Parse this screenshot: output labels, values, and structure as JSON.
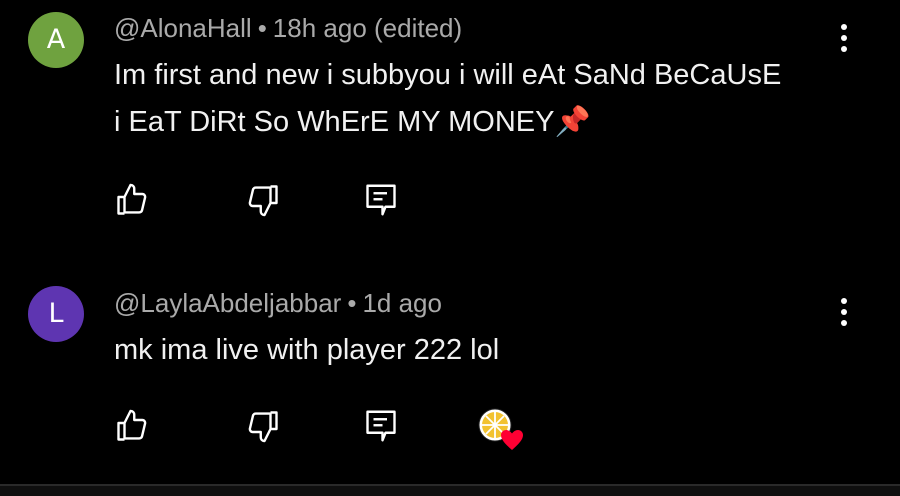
{
  "comments": [
    {
      "avatar_letter": "A",
      "avatar_color": "#6fa23f",
      "author": "@AlonaHall",
      "separator": "•",
      "time": "18h ago",
      "edited": "(edited)",
      "text": "Im first and new i subbyou i will eAt SaNd BeCaUsE i EaT DiRt So WhErE MY MONEY📌"
    },
    {
      "avatar_letter": "L",
      "avatar_color": "#5e35b1",
      "author": "@LaylaAbdeljabbar",
      "separator": "•",
      "time": "1d ago",
      "text": "mk ima live with player 222 lol"
    }
  ],
  "icons": {
    "like": "thumb-up-icon",
    "dislike": "thumb-down-icon",
    "reply": "reply-icon",
    "more": "more-vert-icon",
    "creator_heart": "creator-heart-icon"
  },
  "colors": {
    "background": "#000000",
    "text": "#f1f1f1",
    "meta": "#aaaaaa",
    "heart": "#ff0033"
  }
}
